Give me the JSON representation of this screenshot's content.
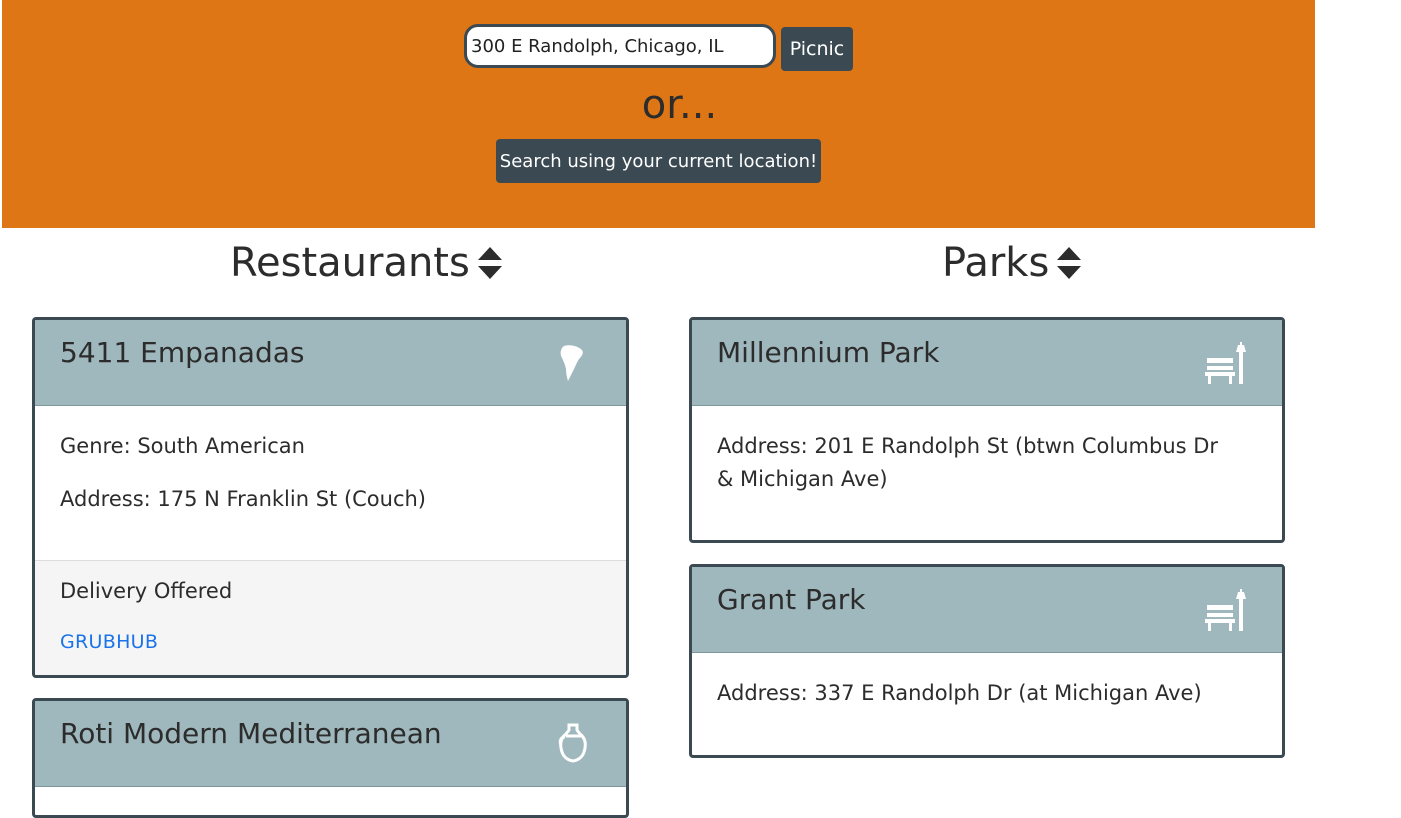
{
  "search": {
    "value": "300 E Randolph, Chicago, IL",
    "button_label": "Picnic",
    "or_text": "or...",
    "location_button_label": "Search using your current location!"
  },
  "colors": {
    "hero": "#de7616",
    "dark": "#3b4a52",
    "card_header": "#9fb8bd",
    "link": "#1a73e8"
  },
  "restaurants": {
    "heading": "Restaurants",
    "sort_icon": "sort-icon",
    "items": [
      {
        "name": "5411 Empanadas",
        "icon": "south-america-icon",
        "genre": "Genre: South American",
        "address": "Address: 175 N Franklin St (Couch)",
        "delivery": "Delivery Offered",
        "delivery_link": "GRUBHUB"
      },
      {
        "name": "Roti Modern Mediterranean",
        "icon": "pottery-jug-icon"
      }
    ]
  },
  "parks": {
    "heading": "Parks",
    "sort_icon": "sort-icon",
    "items": [
      {
        "name": "Millennium Park",
        "icon": "park-bench-icon",
        "address": "Address: 201 E Randolph St (btwn Columbus Dr & Michigan Ave)"
      },
      {
        "name": "Grant Park",
        "icon": "park-bench-icon",
        "address": "Address: 337 E Randolph Dr (at Michigan Ave)"
      }
    ]
  }
}
